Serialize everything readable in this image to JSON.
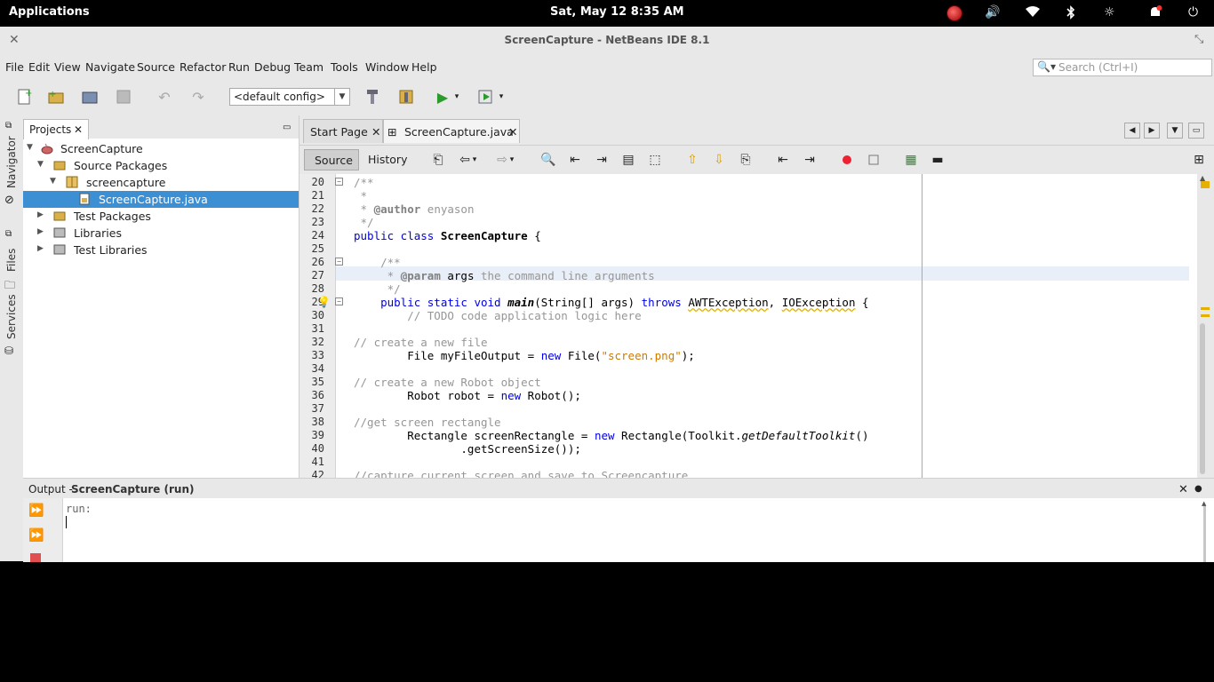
{
  "topbar": {
    "applications": "Applications",
    "datetime": "Sat, May 12   8:35 AM"
  },
  "window": {
    "title": "ScreenCapture - NetBeans IDE 8.1"
  },
  "menubar": {
    "items": [
      "File",
      "Edit",
      "View",
      "Navigate",
      "Source",
      "Refactor",
      "Run",
      "Debug",
      "Team",
      "Tools",
      "Window",
      "Help"
    ],
    "search_placeholder": "Search (Ctrl+I)"
  },
  "toolbar": {
    "config_value": "<default config>"
  },
  "side_strip": {
    "navigator": "Navigator",
    "files": "Files",
    "services": "Services"
  },
  "projects": {
    "tab_label": "Projects",
    "tree": [
      {
        "label": "ScreenCapture",
        "level": 0,
        "expanded": true
      },
      {
        "label": "Source Packages",
        "level": 1,
        "expanded": true
      },
      {
        "label": "screencapture",
        "level": 2,
        "expanded": true
      },
      {
        "label": "ScreenCapture.java",
        "level": 3,
        "selected": true
      },
      {
        "label": "Test Packages",
        "level": 1,
        "expanded": false
      },
      {
        "label": "Libraries",
        "level": 1,
        "expanded": false
      },
      {
        "label": "Test Libraries",
        "level": 1,
        "expanded": false
      }
    ]
  },
  "editor": {
    "tabs": [
      "Start Page",
      "ScreenCapture.java"
    ],
    "active_tab": "ScreenCapture.java",
    "source_label": "Source",
    "history_label": "History",
    "line_numbers": [
      "20",
      "21",
      "22",
      "23",
      "24",
      "25",
      "26",
      "27",
      "28",
      "29",
      "30",
      "31",
      "32",
      "33",
      "34",
      "35",
      "36",
      "37",
      "38",
      "39",
      "40",
      "41",
      "42"
    ],
    "code": {
      "l20": "/**",
      "l21": " *",
      "l22a": " * ",
      "l22b": "@author",
      "l22c": " enyason",
      "l23": " */",
      "l24a": "public class ",
      "l24b": "ScreenCapture",
      "l24c": " {",
      "l26": "    /**",
      "l27a": "     * ",
      "l27b": "@param",
      "l27c": " args",
      "l27d": " the command line arguments",
      "l28": "     */",
      "l29a": "    public static void ",
      "l29b": "main",
      "l29c": "(String[] args) ",
      "l29d": "throws",
      "l29e": " ",
      "l29f": "AWTException",
      "l29g": ", ",
      "l29h": "IOException",
      "l29i": " {",
      "l30": "        // TODO code application logic here",
      "l32": "// create a new file",
      "l33a": "        File myFileOutput = ",
      "l33b": "new",
      "l33c": " File(",
      "l33d": "\"screen.png\"",
      "l33e": ");",
      "l35": "// create a new Robot object",
      "l36a": "        Robot robot = ",
      "l36b": "new",
      "l36c": " Robot();",
      "l38": "//get screen rectangle",
      "l39a": "        Rectangle screenRectangle = ",
      "l39b": "new",
      "l39c": " Rectangle(Toolkit.",
      "l39d": "getDefaultToolkit",
      "l39e": "()",
      "l40": "                .getScreenSize());",
      "l42": "//capture current screen and save to Screencapture"
    }
  },
  "output": {
    "title_prefix": "Output - ",
    "title_name": "ScreenCapture (run)",
    "text": "run:"
  }
}
